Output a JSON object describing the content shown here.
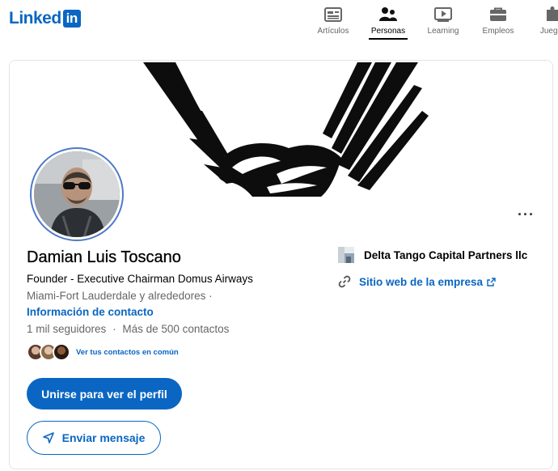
{
  "logo": {
    "text": "Linked",
    "box_text": "in"
  },
  "nav": {
    "items": [
      {
        "label": "Artículos",
        "icon": "articles-icon",
        "active": false
      },
      {
        "label": "Personas",
        "icon": "people-icon",
        "active": true
      },
      {
        "label": "Learning",
        "icon": "learning-icon",
        "active": false
      },
      {
        "label": "Empleos",
        "icon": "jobs-icon",
        "active": false
      },
      {
        "label": "Juegos",
        "icon": "games-icon",
        "active": false
      }
    ]
  },
  "profile": {
    "more_label": "···",
    "name": "Damian Luis Toscano",
    "headline": "Founder - Executive Chairman Domus Airways",
    "location": "Miami-Fort Lauderdale y alrededores  ·",
    "contact_info": "Información de contacto",
    "followers": "1 mil seguidores",
    "separator": "·",
    "connections": "Más de 500 contactos",
    "mutual_text": "Ver tus contactos en común",
    "join_button": "Unirse para ver el perfil",
    "message_button": "Enviar mensaje"
  },
  "company": {
    "name": "Delta Tango Capital Partners llc",
    "website_label": "Sitio web de la empresa"
  },
  "colors": {
    "brand": "#0a66c2",
    "text": "#000000",
    "muted": "#666666",
    "avatar_ring": "#4f79c8"
  }
}
